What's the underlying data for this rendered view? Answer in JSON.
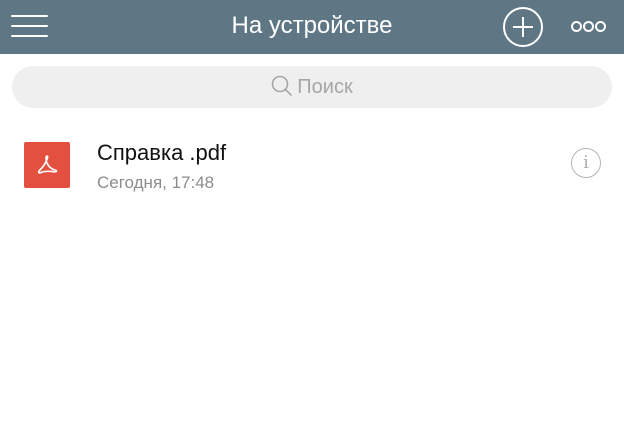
{
  "header": {
    "title": "На устройстве",
    "menu_icon": "hamburger-icon",
    "add_icon": "plus-circle-icon",
    "more_icon": "more-dots-icon",
    "background_color": "#5f7785"
  },
  "search": {
    "placeholder": "Поиск",
    "icon": "search-icon"
  },
  "files": [
    {
      "name": "Справка .pdf",
      "date": "Сегодня, 17:48",
      "icon": "pdf-file-icon",
      "icon_color": "#e4503f",
      "info_glyph": "i"
    }
  ]
}
